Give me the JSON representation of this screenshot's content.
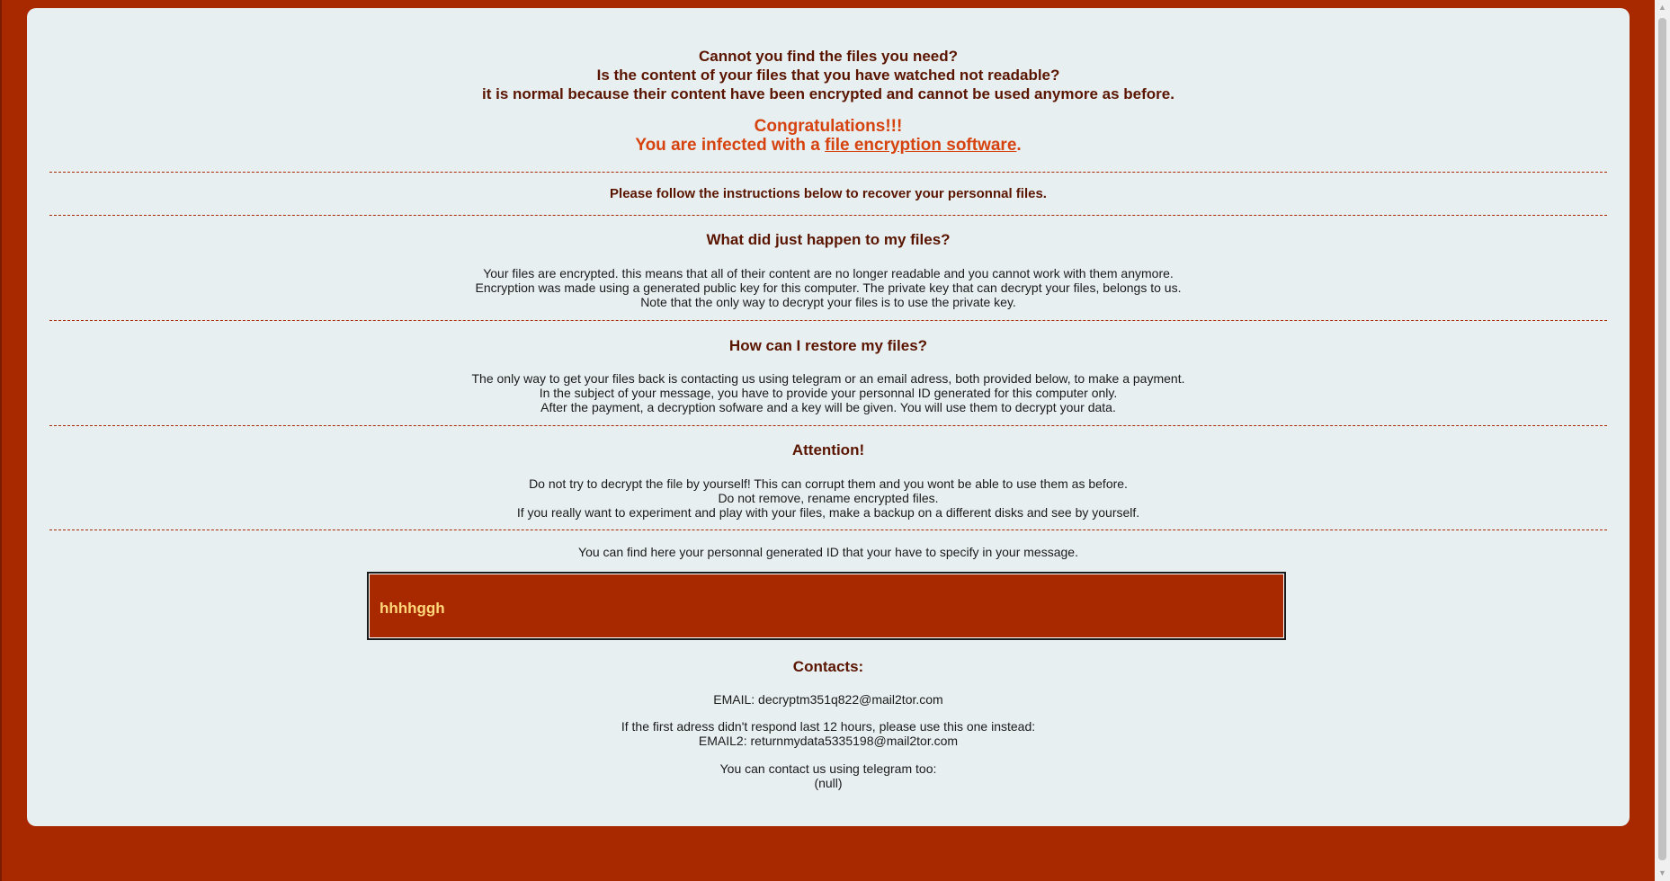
{
  "intro": {
    "line1": "Cannot you find the files you need?",
    "line2": "Is the content of your files that you have watched not readable?",
    "line3": "it is normal because their content have been encrypted and cannot be used anymore as before."
  },
  "congrats": {
    "line1": "Congratulations!!!",
    "line2_prefix": "You are infected with a ",
    "link": "file encryption software",
    "line2_suffix": "."
  },
  "follow": "Please follow the instructions below to recover your personnal files.",
  "section1": {
    "title": "What did just happen to my files?",
    "lines": [
      "Your files are encrypted. this means that all of their content are no longer readable and you cannot work with them anymore.",
      "Encryption was made using a generated public key for this computer. The private key that can decrypt your files, belongs to us.",
      "Note that the only way to decrypt your files is to use the private key."
    ]
  },
  "section2": {
    "title": "How can I restore my files?",
    "lines": [
      "The only way to get your files back is contacting us using telegram or an email adress, both provided below, to make a payment.",
      "In the subject of your message, you have to provide your personnal ID generated for this computer only.",
      "After the payment, a decryption sofware and a key will be given. You will use them to decrypt your data."
    ]
  },
  "section3": {
    "title": "Attention!",
    "lines": [
      "Do not try to decrypt the file by yourself! This can corrupt them and you wont be able to use them as before.",
      "Do not remove, rename encrypted files.",
      "If you really want to experiment and play with your files, make a backup on a different disks and see by yourself."
    ]
  },
  "id_line": "You can find here your personnal generated ID that your have to specify in your message.",
  "personal_id": "hhhhggh",
  "contacts": {
    "title": "Contacts:",
    "email": "EMAIL: decryptm351q822@mail2tor.com",
    "fallback_note": "If the first adress didn't respond last 12 hours, please use this one instead:",
    "email2": "EMAIL2: returnmydata5335198@mail2tor.com",
    "telegram_note": "You can contact us using telegram too:",
    "telegram": "(null)"
  },
  "colors": {
    "background": "#a82800",
    "panel": "#e8eff1",
    "heading": "#5a1500",
    "accent": "#d6430f",
    "id_text": "#ffd87a"
  }
}
